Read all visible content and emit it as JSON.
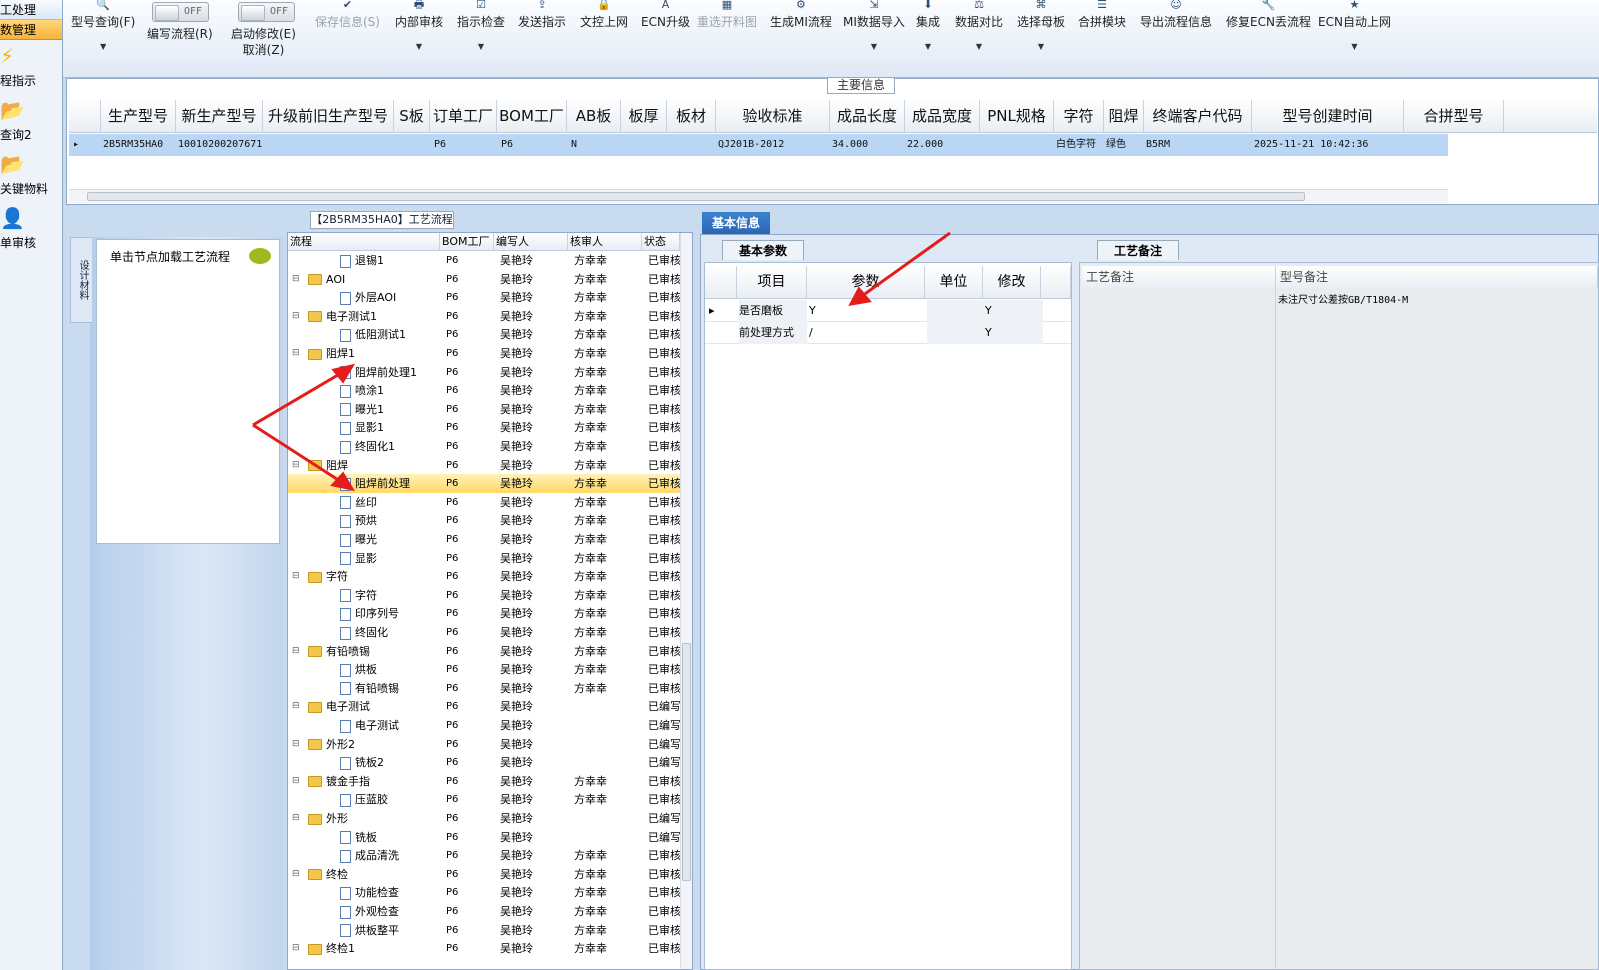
{
  "leftnav": {
    "hdr1": "工处理",
    "hdr2": "数管理",
    "items": [
      "程指示",
      "查询2",
      "关键物料",
      "单审核"
    ]
  },
  "toolbar": {
    "buttons": [
      "型号查询(F)",
      "保存信息(S)",
      "内部审核",
      "指示检查",
      "发送指示",
      "文控上网",
      "ECN升级",
      "重选开料图",
      "生成MI流程",
      "MI数据导入",
      "集成",
      "数据对比",
      "选择母板",
      "合拼模块",
      "导出流程信息",
      "修复ECN丢流程",
      "ECN自动上网"
    ],
    "toggle1_label": "编写流程(R)",
    "toggle2_label": "启动修改(E)",
    "toggle2_sub": "取消(Z)",
    "off": "OFF"
  },
  "main_info": {
    "title": "主要信息",
    "columns": [
      "生产型号",
      "新生产型号",
      "升级前旧生产型号",
      "S板",
      "订单工厂",
      "BOM工厂",
      "AB板",
      "板厚",
      "板材",
      "验收标准",
      "成品长度",
      "成品宽度",
      "PNL规格",
      "字符",
      "阻焊",
      "终端客户代码",
      "型号创建时间",
      "合拼型号"
    ],
    "row": [
      "2B5RM35HA0",
      "10010200207671",
      "",
      "",
      "P6",
      "P6",
      "N",
      "",
      "",
      "QJ201B-2012",
      "34.000",
      "22.000",
      "",
      "白色字符",
      "绿色",
      "B5RM",
      "2025-11-21 10:42:36"
    ]
  },
  "side_tab": "设计材料",
  "load_text": "单击节点加载工艺流程",
  "tree": {
    "title": "【2B5RM35HA0】工艺流程",
    "columns": [
      "流程",
      "BOM工厂",
      "编写人",
      "核审人",
      "状态"
    ],
    "rows": [
      {
        "name": "退锡1",
        "level": 1,
        "bom": "P6",
        "w": "吴艳玲",
        "r": "方幸幸",
        "s": "已审核"
      },
      {
        "name": "AOI",
        "level": 0,
        "bom": "P6",
        "w": "吴艳玲",
        "r": "方幸幸",
        "s": "已审核"
      },
      {
        "name": "外层AOI",
        "level": 1,
        "bom": "P6",
        "w": "吴艳玲",
        "r": "方幸幸",
        "s": "已审核"
      },
      {
        "name": "电子测试1",
        "level": 0,
        "bom": "P6",
        "w": "吴艳玲",
        "r": "方幸幸",
        "s": "已审核"
      },
      {
        "name": "低阻测试1",
        "level": 1,
        "bom": "P6",
        "w": "吴艳玲",
        "r": "方幸幸",
        "s": "已审核"
      },
      {
        "name": "阻焊1",
        "level": 0,
        "bom": "P6",
        "w": "吴艳玲",
        "r": "方幸幸",
        "s": "已审核"
      },
      {
        "name": "阻焊前处理1",
        "level": 1,
        "bom": "P6",
        "w": "吴艳玲",
        "r": "方幸幸",
        "s": "已审核"
      },
      {
        "name": "喷涂1",
        "level": 1,
        "bom": "P6",
        "w": "吴艳玲",
        "r": "方幸幸",
        "s": "已审核"
      },
      {
        "name": "曝光1",
        "level": 1,
        "bom": "P6",
        "w": "吴艳玲",
        "r": "方幸幸",
        "s": "已审核"
      },
      {
        "name": "显影1",
        "level": 1,
        "bom": "P6",
        "w": "吴艳玲",
        "r": "方幸幸",
        "s": "已审核"
      },
      {
        "name": "终固化1",
        "level": 1,
        "bom": "P6",
        "w": "吴艳玲",
        "r": "方幸幸",
        "s": "已审核"
      },
      {
        "name": "阻焊",
        "level": 0,
        "bom": "P6",
        "w": "吴艳玲",
        "r": "方幸幸",
        "s": "已审核"
      },
      {
        "name": "阻焊前处理",
        "level": 1,
        "bom": "P6",
        "w": "吴艳玲",
        "r": "方幸幸",
        "s": "已审核",
        "sel": true
      },
      {
        "name": "丝印",
        "level": 1,
        "bom": "P6",
        "w": "吴艳玲",
        "r": "方幸幸",
        "s": "已审核"
      },
      {
        "name": "预烘",
        "level": 1,
        "bom": "P6",
        "w": "吴艳玲",
        "r": "方幸幸",
        "s": "已审核"
      },
      {
        "name": "曝光",
        "level": 1,
        "bom": "P6",
        "w": "吴艳玲",
        "r": "方幸幸",
        "s": "已审核"
      },
      {
        "name": "显影",
        "level": 1,
        "bom": "P6",
        "w": "吴艳玲",
        "r": "方幸幸",
        "s": "已审核"
      },
      {
        "name": "字符",
        "level": 0,
        "bom": "P6",
        "w": "吴艳玲",
        "r": "方幸幸",
        "s": "已审核"
      },
      {
        "name": "字符",
        "level": 1,
        "bom": "P6",
        "w": "吴艳玲",
        "r": "方幸幸",
        "s": "已审核"
      },
      {
        "name": "印序列号",
        "level": 1,
        "bom": "P6",
        "w": "吴艳玲",
        "r": "方幸幸",
        "s": "已审核"
      },
      {
        "name": "终固化",
        "level": 1,
        "bom": "P6",
        "w": "吴艳玲",
        "r": "方幸幸",
        "s": "已审核"
      },
      {
        "name": "有铅喷锡",
        "level": 0,
        "bom": "P6",
        "w": "吴艳玲",
        "r": "方幸幸",
        "s": "已审核"
      },
      {
        "name": "烘板",
        "level": 1,
        "bom": "P6",
        "w": "吴艳玲",
        "r": "方幸幸",
        "s": "已审核"
      },
      {
        "name": "有铅喷锡",
        "level": 1,
        "bom": "P6",
        "w": "吴艳玲",
        "r": "方幸幸",
        "s": "已审核"
      },
      {
        "name": "电子测试",
        "level": 0,
        "bom": "P6",
        "w": "吴艳玲",
        "r": "",
        "s": "已编写"
      },
      {
        "name": "电子测试",
        "level": 1,
        "bom": "P6",
        "w": "吴艳玲",
        "r": "",
        "s": "已编写"
      },
      {
        "name": "外形2",
        "level": 0,
        "bom": "P6",
        "w": "吴艳玲",
        "r": "",
        "s": "已编写"
      },
      {
        "name": "铣板2",
        "level": 1,
        "bom": "P6",
        "w": "吴艳玲",
        "r": "",
        "s": "已编写"
      },
      {
        "name": "镀金手指",
        "level": 0,
        "bom": "P6",
        "w": "吴艳玲",
        "r": "方幸幸",
        "s": "已审核"
      },
      {
        "name": "压蓝胶",
        "level": 1,
        "bom": "P6",
        "w": "吴艳玲",
        "r": "方幸幸",
        "s": "已审核"
      },
      {
        "name": "外形",
        "level": 0,
        "bom": "P6",
        "w": "吴艳玲",
        "r": "",
        "s": "已编写"
      },
      {
        "name": "铣板",
        "level": 1,
        "bom": "P6",
        "w": "吴艳玲",
        "r": "",
        "s": "已编写"
      },
      {
        "name": "成品清洗",
        "level": 1,
        "bom": "P6",
        "w": "吴艳玲",
        "r": "方幸幸",
        "s": "已审核"
      },
      {
        "name": "终检",
        "level": 0,
        "bom": "P6",
        "w": "吴艳玲",
        "r": "方幸幸",
        "s": "已审核"
      },
      {
        "name": "功能检查",
        "level": 1,
        "bom": "P6",
        "w": "吴艳玲",
        "r": "方幸幸",
        "s": "已审核"
      },
      {
        "name": "外观检查",
        "level": 1,
        "bom": "P6",
        "w": "吴艳玲",
        "r": "方幸幸",
        "s": "已审核"
      },
      {
        "name": "烘板整平",
        "level": 1,
        "bom": "P6",
        "w": "吴艳玲",
        "r": "方幸幸",
        "s": "已审核"
      },
      {
        "name": "终检1",
        "level": 0,
        "bom": "P6",
        "w": "吴艳玲",
        "r": "方幸幸",
        "s": "已审核"
      }
    ]
  },
  "basic": {
    "tab": "基本信息",
    "subtab": "基本参数",
    "columns": [
      "项目",
      "参数",
      "单位",
      "修改"
    ],
    "rows": [
      [
        "是否磨板",
        "Y",
        "",
        "Y"
      ],
      [
        "前处理方式",
        "/",
        "",
        "Y"
      ]
    ]
  },
  "notes": {
    "tab": "工艺备注",
    "col1": "工艺备注",
    "col2": "型号备注",
    "value": "未注尺寸公差按GB/T1804-M"
  }
}
